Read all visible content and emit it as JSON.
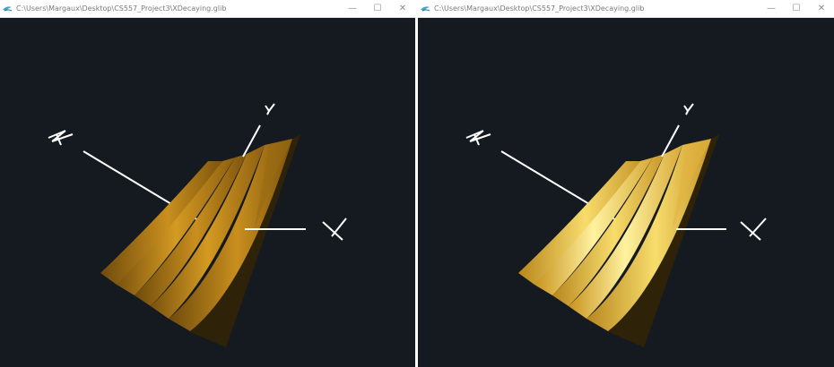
{
  "windows": [
    {
      "title": "C:\\Users\\Margaux\\Desktop\\CS557_Project3\\XDecaying.glib",
      "controls": {
        "minimize": "—",
        "maximize": "☐",
        "close": "✕"
      },
      "colors": {
        "background": "#151a20",
        "surface_light": "#e2ab2a",
        "surface_mid": "#b07d1a",
        "surface_dark": "#6e4a0c",
        "surface_shadow": "#3a2a08",
        "axis": "#ffffff"
      },
      "icons": [
        "glman-app-icon",
        "minimize-icon",
        "maximize-icon",
        "close-icon"
      ]
    },
    {
      "title": "C:\\Users\\Margaux\\Desktop\\CS557_Project3\\XDecaying.glib",
      "controls": {
        "minimize": "—",
        "maximize": "☐",
        "close": "✕"
      },
      "colors": {
        "background": "#151a20",
        "surface_light": "#fff09a",
        "surface_mid": "#e9c052",
        "surface_dark": "#b8861e",
        "surface_shadow": "#3a2a08",
        "axis": "#ffffff"
      },
      "icons": [
        "glman-app-icon",
        "minimize-icon",
        "maximize-icon",
        "close-icon"
      ]
    }
  ]
}
